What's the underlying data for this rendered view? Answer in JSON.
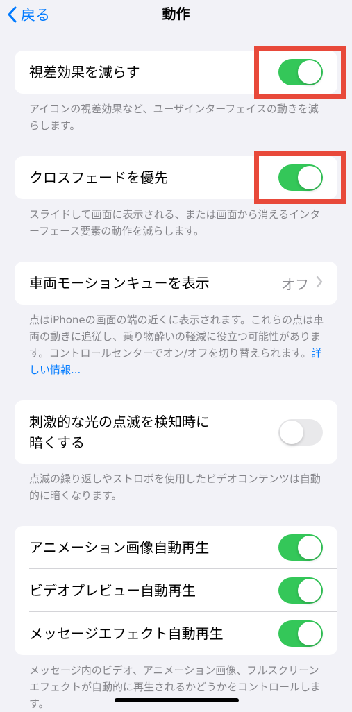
{
  "nav": {
    "back_label": "戻る",
    "title": "動作"
  },
  "reduce_motion": {
    "label": "視差効果を減らす",
    "state": "on",
    "footnote": "アイコンの視差効果など、ユーザインターフェイスの動きを減らします。"
  },
  "cross_fade": {
    "label": "クロスフェードを優先",
    "state": "on",
    "footnote": "スライドして画面に表示される、または画面から消えるインターフェース要素の動作を減らします。"
  },
  "vehicle_motion": {
    "label": "車両モーションキューを表示",
    "value": "オフ",
    "footnote": "点はiPhoneの画面の端の近くに表示されます。これらの点は車両の動きに追従し、乗り物酔いの軽減に役立つ可能性があります。コントロールセンターでオン/オフを切り替えられます。",
    "link": "詳しい情報..."
  },
  "dim_flashing": {
    "label_line1": "刺激的な光の点滅を検知時に",
    "label_line2": "暗くする",
    "state": "off",
    "footnote": "点滅の繰り返しやストロボを使用したビデオコンテンツは自動的に暗くなります。"
  },
  "autoplay": {
    "items": [
      {
        "label": "アニメーション画像自動再生",
        "state": "on"
      },
      {
        "label": "ビデオプレビュー自動再生",
        "state": "on"
      },
      {
        "label": "メッセージエフェクト自動再生",
        "state": "on"
      }
    ],
    "footnote": "メッセージ内のビデオ、アニメーション画像、フルスクリーンエフェクトが自動的に再生されるかどうかをコントロールします。"
  },
  "colors": {
    "accent": "#007aff",
    "toggle_on": "#34c759",
    "highlight": "#e8493a"
  }
}
